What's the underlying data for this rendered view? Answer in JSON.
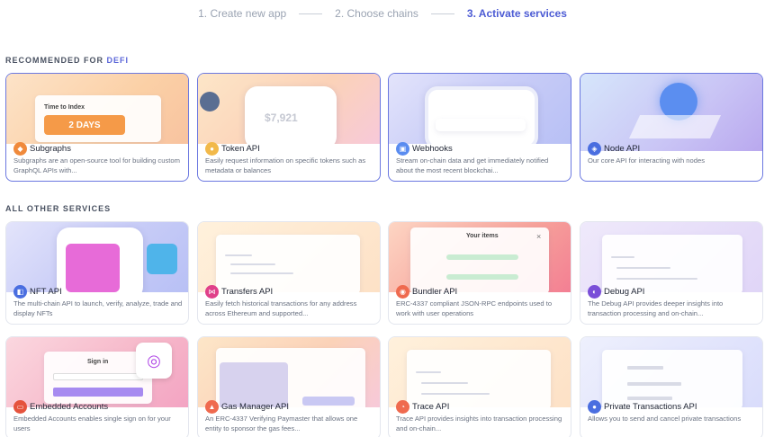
{
  "stepper": {
    "steps": [
      "1. Create new app",
      "2. Choose chains",
      "3. Activate services"
    ],
    "active_index": 2
  },
  "sections": {
    "recommended_prefix": "RECOMMENDED FOR",
    "recommended_accent": "DEFI",
    "other": "ALL OTHER SERVICES"
  },
  "recommended": [
    {
      "title": "Subgraphs",
      "desc": "Subgraphs are an open-source tool for building custom GraphQL APIs with...",
      "icon": "subgraph-icon",
      "art": {
        "label": "Time to Index",
        "value": "2 DAYS"
      }
    },
    {
      "title": "Token API",
      "desc": "Easily request information on specific tokens such as metadata or balances",
      "icon": "token-icon",
      "art": {
        "amount": "$7,921"
      }
    },
    {
      "title": "Webhooks",
      "desc": "Stream on-chain data and get immediately notified about the most recent blockchai...",
      "icon": "webhook-icon"
    },
    {
      "title": "Node API",
      "desc": "Our core API for interacting with nodes",
      "icon": "node-icon"
    }
  ],
  "others_row1": [
    {
      "title": "NFT API",
      "desc": "The multi-chain API to launch, verify, analyze, trade and display NFTs",
      "icon": "nft-icon"
    },
    {
      "title": "Transfers API",
      "desc": "Easily fetch historical transactions for any address across Ethereum and supported...",
      "icon": "transfers-icon"
    },
    {
      "title": "Bundler API",
      "desc": "ERC-4337 compliant JSON-RPC endpoints used to work with user operations",
      "icon": "bundler-icon",
      "art": {
        "header": "Your items"
      }
    },
    {
      "title": "Debug API",
      "desc": "The Debug API provides deeper insights into transaction processing and on-chain...",
      "icon": "debug-icon"
    }
  ],
  "others_row2": [
    {
      "title": "Embedded Accounts",
      "desc": "Embedded Accounts enables single sign on for your users",
      "icon": "accounts-icon",
      "art": {
        "header": "Sign in"
      }
    },
    {
      "title": "Gas Manager API",
      "desc": "An ERC-4337 Verifying Paymaster that allows one entity to sponsor the gas fees...",
      "icon": "gas-icon"
    },
    {
      "title": "Trace API",
      "desc": "Trace API provides insights into transaction processing and on-chain...",
      "icon": "trace-icon"
    },
    {
      "title": "Private Transactions API",
      "desc": "Allows you to send and cancel private transactions",
      "icon": "private-tx-icon"
    }
  ]
}
